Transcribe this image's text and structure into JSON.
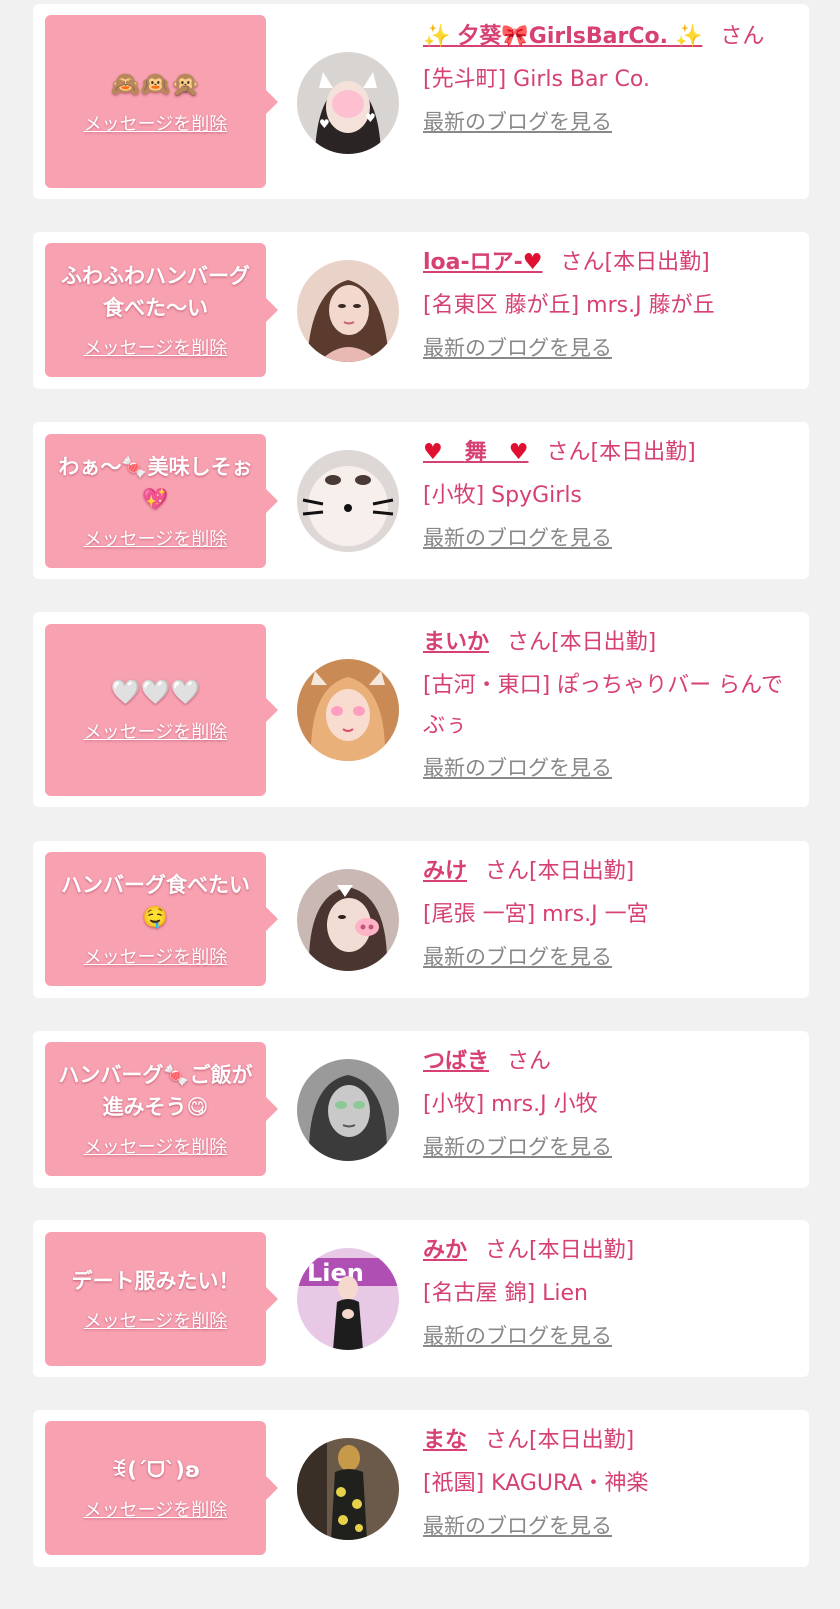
{
  "delete_label": "メッセージを削除",
  "blog_label": "最新のブログを見る",
  "colors": {
    "accent": "#d64073",
    "bubble": "#f7a1b1",
    "page_bg": "#f1f1f1",
    "card_bg": "#ffffff",
    "link_gray": "#888888"
  },
  "cards": [
    {
      "message": "🙈🙉🙊",
      "name_prefix": "✨ ",
      "name": "夕葵🎀GirlsBarCo.",
      "name_suffix": " ✨",
      "suffix": "さん",
      "shop": "[先斗町] Girls Bar Co.",
      "avatar_icon": "girl-with-cat-ears-photo"
    },
    {
      "message": "ふわふわハンバーグ食べた〜い",
      "name_prefix": "",
      "name": "loa-ロア-",
      "name_suffix": "♥",
      "suffix": "さん[本日出勤]",
      "shop": "[名東区 藤が丘] mrs.J 藤が丘",
      "avatar_icon": "woman-portrait-photo"
    },
    {
      "message": "わぁ〜🍬美味しそぉ💖",
      "name_prefix": "♥　",
      "name": "舞",
      "name_suffix": "　♥",
      "suffix": "さん[本日出勤]",
      "shop": "[小牧] SpyGirls",
      "avatar_icon": "kitty-face-filter-photo"
    },
    {
      "message": "🤍🤍🤍",
      "name_prefix": "",
      "name": "まいか",
      "name_suffix": "",
      "suffix": "さん[本日出勤]",
      "shop": "[古河・東口] ぽっちゃりバー らんでぶぅ",
      "avatar_icon": "cat-filter-selfie-photo"
    },
    {
      "message": "ハンバーグ食べたい🤤",
      "name_prefix": "",
      "name": "みけ",
      "name_suffix": "",
      "suffix": "さん[本日出勤]",
      "shop": "[尾張 一宮] mrs.J 一宮",
      "avatar_icon": "pig-nose-filter-photo"
    },
    {
      "message": "ハンバーグ🍬ご飯が進みそう😋",
      "name_prefix": "",
      "name": "つばき",
      "name_suffix": "",
      "suffix": "さん",
      "shop": "[小牧] mrs.J 小牧",
      "avatar_icon": "monochrome-portrait-photo"
    },
    {
      "message": "デート服みたい！",
      "name_prefix": "",
      "name": "みか",
      "name_suffix": "",
      "suffix": "さん[本日出勤]",
      "shop": "[名古屋 錦] Lien",
      "avatar_icon": "lien-promo-photo"
    },
    {
      "message": "ꉂ(ˊᗜˋ)ʚ",
      "name_prefix": "",
      "name": "まな",
      "name_suffix": "",
      "suffix": "さん[本日出勤]",
      "shop": "[祇園] KAGURA・神楽",
      "avatar_icon": "kimono-photo"
    }
  ]
}
